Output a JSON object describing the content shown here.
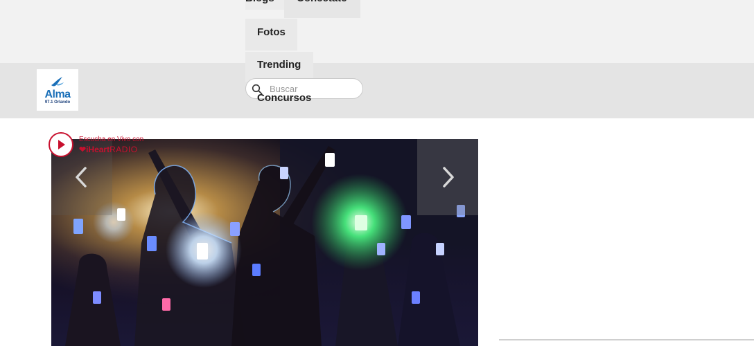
{
  "site": {
    "logo_name": "Alma",
    "logo_frequency": "97.1 Orlando"
  },
  "nav": {
    "items": [
      {
        "label": "Blogs"
      },
      {
        "label": "Conectate"
      },
      {
        "label": "Fotos"
      },
      {
        "label": "Trending"
      },
      {
        "label": "Concursos"
      }
    ]
  },
  "search": {
    "placeholder": "Buscar",
    "icon": "search-icon"
  },
  "listen_live": {
    "text": "Escucha en Vivo con",
    "brand": "iHeart",
    "brand_suffix": "RADIO",
    "icon": "play-icon",
    "color": "#c8102e"
  },
  "carousel": {
    "image_alt": "Concert crowd holding up glowing phones",
    "prev_icon": "chevron-left-icon",
    "next_icon": "chevron-right-icon"
  },
  "colors": {
    "header_bg": "#e4e4e4",
    "top_band_bg": "#f2f2f2",
    "logo_blue": "#1a6fb8"
  }
}
